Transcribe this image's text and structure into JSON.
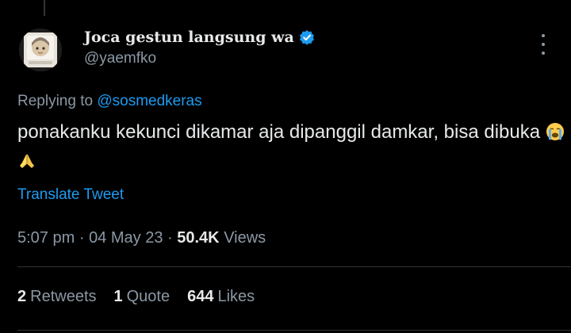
{
  "tweet": {
    "display_name": "Joca gestun langsung wa",
    "handle": "@yaemfko",
    "replying_prefix": "Replying to",
    "replying_to": "@sosmedkeras",
    "text": "ponakanku kekunci dikamar aja dipanggil damkar, bisa dibuka",
    "emojis": [
      "loudly-crying-face",
      "folded-hands"
    ],
    "translate_label": "Translate Tweet",
    "time": "5:07 pm",
    "date": "04 May 23",
    "separator": "·",
    "views_count": "50.4K",
    "views_label": "Views"
  },
  "stats": {
    "retweets_count": "2",
    "retweets_label": "Retweets",
    "quotes_count": "1",
    "quotes_label": "Quote",
    "likes_count": "644",
    "likes_label": "Likes"
  },
  "colors": {
    "background": "#000000",
    "text": "#e7e9ea",
    "secondary": "#8b98a5",
    "accent": "#1d9bf0"
  }
}
